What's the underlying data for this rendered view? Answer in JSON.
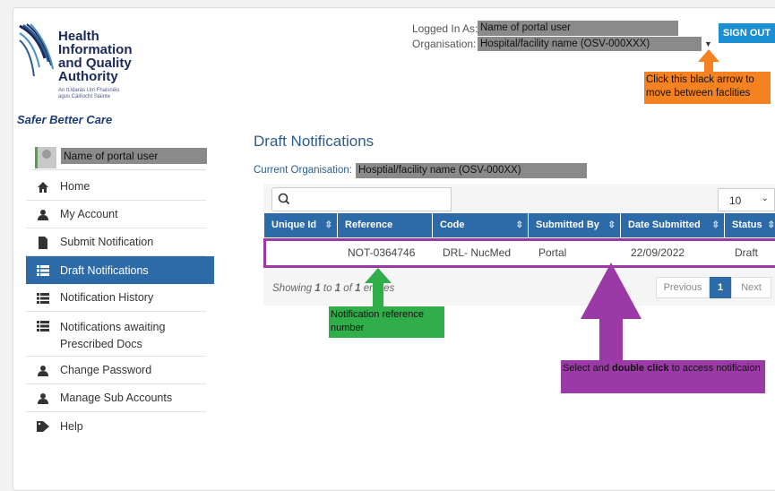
{
  "header": {
    "logged_in_label": "Logged In As:",
    "logged_in_value": "Name of portal user",
    "org_label": "Organisation:",
    "org_value": "Hospital/facility name (OSV-000XXX)",
    "sign_out": "SIGN OUT"
  },
  "logo": {
    "line1": "Health",
    "line2": "Information",
    "line3": "and Quality",
    "line4": "Authority",
    "irish1": "An tÚdarás Um Fhaisnéis",
    "irish2": "agus Cáilíocht Sláinte",
    "tagline": "Safer Better Care"
  },
  "sidebar": {
    "user_name": "Name of portal user",
    "items": [
      {
        "label": "Home",
        "icon": "home-icon"
      },
      {
        "label": "My Account",
        "icon": "user-icon"
      },
      {
        "label": "Submit Notification",
        "icon": "document-icon"
      },
      {
        "label": "Draft Notifications",
        "icon": "list-icon",
        "active": true
      },
      {
        "label": "Notification History",
        "icon": "list-icon"
      },
      {
        "label": "Notifications awaiting Prescribed Docs",
        "icon": "list-icon"
      },
      {
        "label": "Change Password",
        "icon": "user-icon"
      },
      {
        "label": "Manage Sub Accounts",
        "icon": "user-icon"
      },
      {
        "label": "Help",
        "icon": "tags-icon"
      }
    ]
  },
  "main": {
    "title": "Draft Notifications",
    "current_org_label": "Current Organisation:",
    "current_org_value": "Hosptial/facility name (OSV-000XX)",
    "page_size": "10",
    "columns": [
      "Unique Id",
      "Reference",
      "Code",
      "Submitted By",
      "Date Submitted",
      "Status"
    ],
    "rows": [
      {
        "unique_id": "",
        "reference": "NOT-0364746",
        "code": "DRL- NucMed",
        "submitted_by": "Portal",
        "date_submitted": "22/09/2022",
        "status": "Draft"
      }
    ],
    "showing_prefix": "Showing ",
    "showing_from": "1",
    "showing_to_word": " to ",
    "showing_to": "1",
    "showing_of_word": " of ",
    "showing_total": "1",
    "showing_suffix": " entries",
    "pager": {
      "previous": "Previous",
      "current": "1",
      "next": "Next"
    }
  },
  "annotations": {
    "orange": "Click this black arrow to move between faclities",
    "green": "Notification reference number",
    "purple_pre": "Select and ",
    "purple_bold": "double click",
    "purple_post": " to access notificaion"
  },
  "colors": {
    "accent": "#2d6aa8",
    "signout": "#1b8fd2",
    "orange": "#f58220",
    "green": "#2fae4a",
    "purple": "#9b3aa6"
  }
}
